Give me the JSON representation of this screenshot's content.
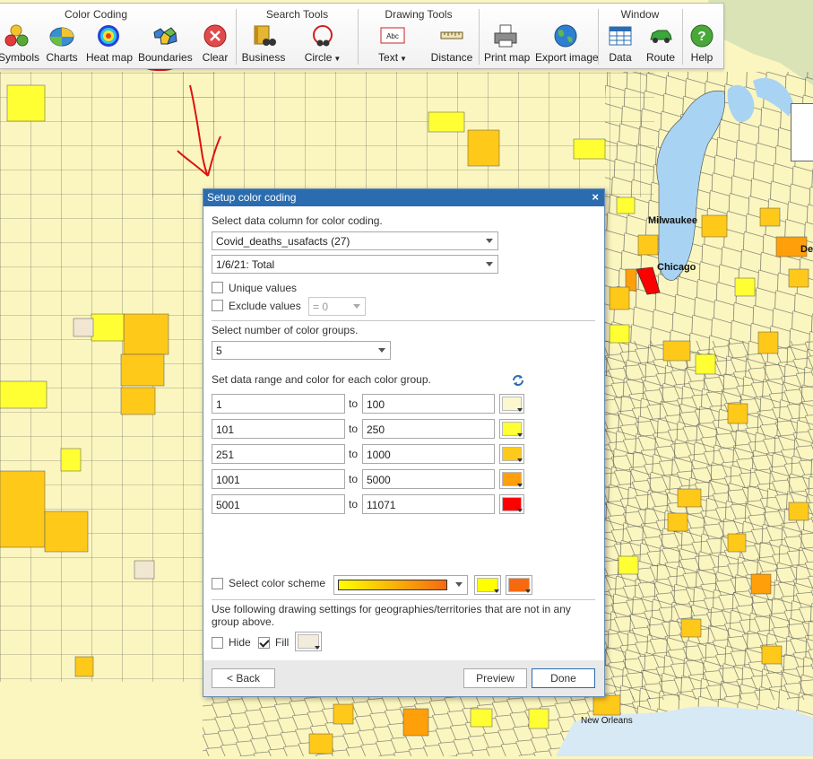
{
  "map": {
    "labels": [
      "Milwaukee",
      "Chicago",
      "New Orleans",
      "Det"
    ]
  },
  "toolbar": {
    "groups": {
      "color_coding": "Color Coding",
      "search_tools": "Search Tools",
      "drawing_tools": "Drawing Tools",
      "window": "Window"
    },
    "tools": {
      "symbols": "Symbols",
      "charts": "Charts",
      "heat_map": "Heat map",
      "boundaries": "Boundaries",
      "clear": "Clear",
      "business": "Business",
      "circle": "Circle",
      "text": "Text",
      "distance": "Distance",
      "print_map": "Print map",
      "export_image": "Export image",
      "data": "Data",
      "route": "Route",
      "help": "Help"
    },
    "text_icon_label": "Abc"
  },
  "dialog": {
    "title": "Setup color coding",
    "close": "×",
    "select_column_label": "Select data column for color coding.",
    "data_column": "Covid_deaths_usafacts (27)",
    "data_sub_column": "1/6/21: Total",
    "unique_values_label": "Unique values",
    "unique_values_checked": false,
    "exclude_values_label": "Exclude values",
    "exclude_values_checked": false,
    "exclude_value": "= 0",
    "num_groups_label": "Select number of color groups.",
    "num_groups": "5",
    "range_label": "Set data range and color for each color group.",
    "to_label": "to",
    "ranges": [
      {
        "from": "1",
        "to": "100",
        "color": "#fdf7cf"
      },
      {
        "from": "101",
        "to": "250",
        "color": "#ffff33"
      },
      {
        "from": "251",
        "to": "1000",
        "color": "#ffc91a"
      },
      {
        "from": "1001",
        "to": "5000",
        "color": "#ff9f0a"
      },
      {
        "from": "5001",
        "to": "11071",
        "color": "#ff0000"
      }
    ],
    "color_scheme_label": "Select color scheme",
    "color_scheme_checked": false,
    "scheme_start_color": "#ffff00",
    "scheme_end_color": "#f56a10",
    "drawing_settings_text": "Use following drawing settings for geographies/territories that are not in any group above.",
    "hide_label": "Hide",
    "hide_checked": false,
    "fill_label": "Fill",
    "fill_checked": true,
    "fill_color": "#f3ecdc",
    "back_button": "< Back",
    "preview_button": "Preview",
    "done_button": "Done"
  },
  "colors": {
    "accent": "#2b6cb0",
    "lake": "#a9d3f2",
    "county_light": "#fbf6bf",
    "county_yellow": "#ffff33",
    "county_gold": "#ffc91a",
    "county_orange": "#ff9f0a",
    "county_red": "#ff0000",
    "annotation": "#e01010"
  }
}
